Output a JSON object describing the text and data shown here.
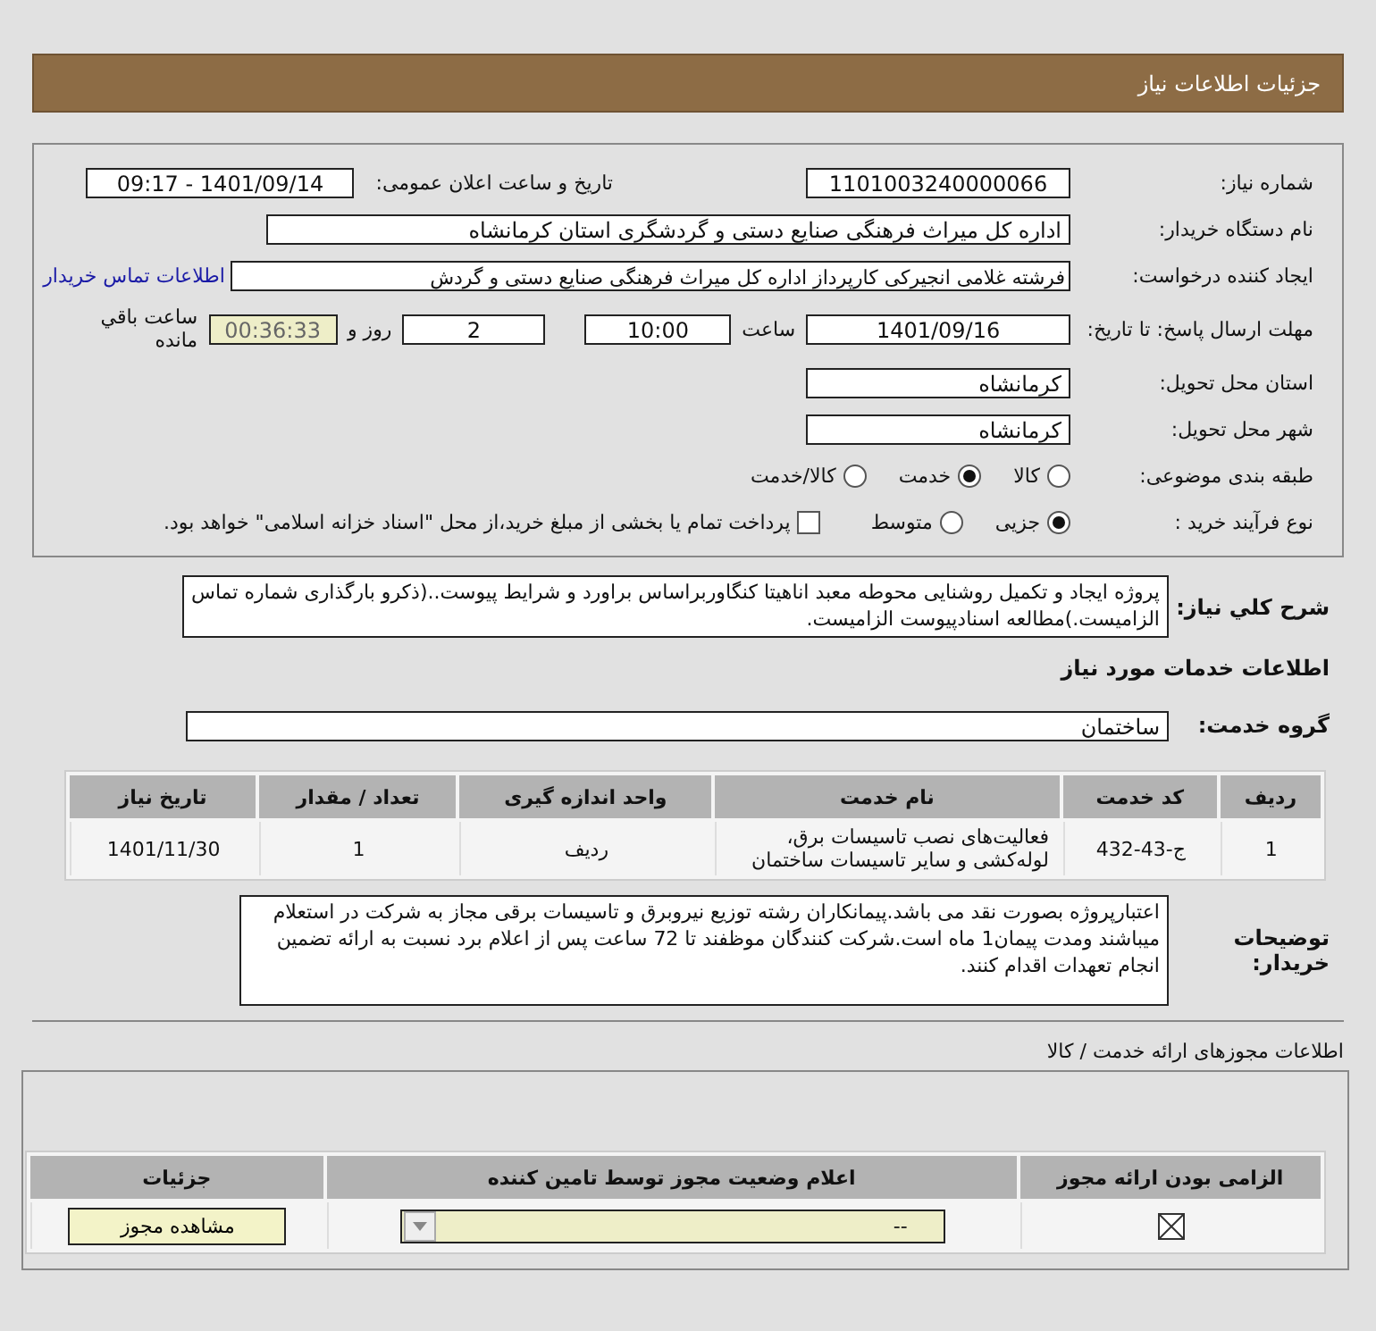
{
  "header": {
    "title": "جزئیات اطلاعات نیاز"
  },
  "need_number": {
    "label": "شماره نیاز:",
    "value": "1101003240000066"
  },
  "announce": {
    "label": "تاریخ و ساعت اعلان عمومی:",
    "value": "1401/09/14 - 09:17"
  },
  "buyer": {
    "label": "نام دستگاه خریدار:",
    "value": "اداره کل میراث فرهنگی  صنایع دستی و گردشگری استان کرمانشاه"
  },
  "requester": {
    "label": "ایجاد کننده درخواست:",
    "value": "فرشته غلامی انجیرکی کارپرداز اداره کل میراث فرهنگی  صنایع دستی و گردش",
    "link": "اطلاعات تماس خریدار"
  },
  "deadline": {
    "label": "مهلت ارسال پاسخ: تا تاریخ:",
    "date": "1401/09/16",
    "time_label": "ساعت",
    "time": "10:00",
    "days": "2",
    "days_label": "روز و",
    "remaining": "00:36:33",
    "remaining_label": "ساعت باقي مانده"
  },
  "province": {
    "label": "استان محل تحویل:",
    "value": "کرمانشاه"
  },
  "city": {
    "label": "شهر محل تحویل:",
    "value": "کرمانشاه"
  },
  "category": {
    "label": "طبقه بندی موضوعی:",
    "options": [
      {
        "label": "کالا",
        "selected": false
      },
      {
        "label": "خدمت",
        "selected": true
      },
      {
        "label": "کالا/خدمت",
        "selected": false
      }
    ]
  },
  "purchase_type": {
    "label": "نوع فرآیند خرید :",
    "options": [
      {
        "label": "جزیی",
        "selected": true
      },
      {
        "label": "متوسط",
        "selected": false
      }
    ],
    "treasury": {
      "label": "پرداخت تمام یا بخشی از مبلغ خرید،از محل \"اسناد خزانه اسلامی\" خواهد بود.",
      "checked": false
    }
  },
  "description": {
    "label": "شرح کلي نياز:",
    "value": "پروژه ایجاد و تکمیل روشنایی محوطه معبد اناهیتا کنگاوربراساس براورد و شرایط پیوست..(ذکرو بارگذاری شماره تماس الزامیست.)مطالعه اسنادپیوست الزامیست."
  },
  "services_heading": "اطلاعات خدمات مورد نیاز",
  "service_group": {
    "label": "گروه خدمت:",
    "value": "ساختمان"
  },
  "services_table": {
    "columns": [
      "ردیف",
      "کد خدمت",
      "نام خدمت",
      "واحد اندازه گیری",
      "تعداد / مقدار",
      "تاریخ نیاز"
    ],
    "rows": [
      [
        "1",
        "ج-43-432",
        "فعالیت‌های نصب تاسیسات برق، لوله‌کشی و سایر تاسیسات ساختمان",
        "ردیف",
        "1",
        "1401/11/30"
      ]
    ]
  },
  "buyer_notes": {
    "label": "توضیحات خریدار:",
    "value": "اعتبارپروژه بصورت  نقد می باشد.پیمانکاران رشته توزیع نیروبرق و تاسیسات برقی مجاز به شرکت در استعلام میباشند ومدت پیمان1 ماه است.شرکت کنندگان موظفند تا 72 ساعت پس از اعلام برد نسبت به ارائه تضمین انجام تعهدات اقدام کنند."
  },
  "permits": {
    "title": "اطلاعات مجوزهای ارائه خدمت / کالا",
    "columns": [
      "الزامی بودن ارائه مجوز",
      "اعلام وضعیت مجوز توسط تامین کننده",
      "جزئیات"
    ],
    "rows": [
      {
        "required": true,
        "status": "--",
        "action": "مشاهده مجوز"
      }
    ]
  }
}
